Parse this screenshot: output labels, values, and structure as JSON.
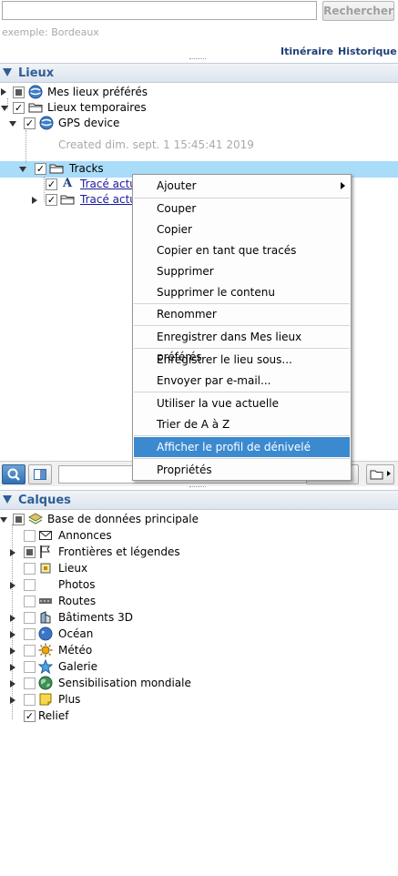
{
  "search": {
    "button_label": "Rechercher",
    "hint": "exemple: Bordeaux",
    "value": ""
  },
  "links": {
    "itineraire": "Itinéraire",
    "historique": "Historique"
  },
  "places_panel": {
    "title": "Lieux",
    "items": {
      "favorites": "Mes lieux préférés",
      "temporary": "Lieux temporaires",
      "gps": "GPS device",
      "created": "Created dim. sept. 1 15:45:41 2019",
      "tracks": "Tracks",
      "trace1": "Tracé actu",
      "trace2": "Tracé actu"
    }
  },
  "context_menu": {
    "items": [
      "Ajouter",
      "Couper",
      "Copier",
      "Copier en tant que tracés",
      "Supprimer",
      "Supprimer le contenu",
      "Renommer",
      "Enregistrer dans Mes lieux préférés",
      "Enregistrer le lieu sous...",
      "Envoyer par e-mail...",
      "Utiliser la vue actuelle",
      "Trier de A à Z",
      "Afficher le profil de dénivelé",
      "Propriétés"
    ],
    "highlighted": "Afficher le profil de dénivelé"
  },
  "layers_panel": {
    "title": "Calques",
    "root": "Base de données principale",
    "items": [
      "Annonces",
      "Frontières et légendes",
      "Lieux",
      "Photos",
      "Routes",
      "Bâtiments 3D",
      "Océan",
      "Météo",
      "Galerie",
      "Sensibilisation mondiale",
      "Plus",
      "Relief"
    ]
  },
  "colors": {
    "panel_title": "#2f5e96",
    "selection": "#a8dcf9",
    "menu_highlight": "#3b8ad0",
    "link": "#1a1a9c"
  }
}
